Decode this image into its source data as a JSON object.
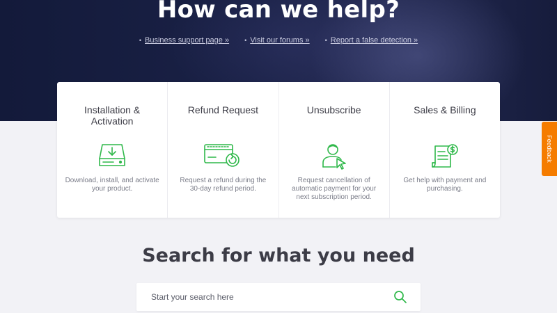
{
  "hero": {
    "title": "How can we help?",
    "links": [
      {
        "label": "Business support page »"
      },
      {
        "label": "Visit our forums »"
      },
      {
        "label": "Report a false detection »"
      }
    ],
    "bullet": "•"
  },
  "cards": [
    {
      "title": "Installation & Activation",
      "icon": "download-drive-icon",
      "description": "Download, install, and activate your product."
    },
    {
      "title": "Refund Request",
      "icon": "refund-card-icon",
      "description": "Request a refund during the 30-day refund period."
    },
    {
      "title": "Unsubscribe",
      "icon": "user-cursor-icon",
      "description": "Request cancellation of automatic payment for your next subscription period."
    },
    {
      "title": "Sales & Billing",
      "icon": "invoice-dollar-icon",
      "description": "Get help with payment and purchasing."
    }
  ],
  "feedback": {
    "label": "Feedback"
  },
  "search": {
    "title": "Search for what you need",
    "placeholder": "Start your search here",
    "icon": "search-icon"
  },
  "colors": {
    "accent": "#2fb84a",
    "feedback": "#f57c00",
    "hero_bg": "#1a2146",
    "page_bg": "#f2f2f6"
  }
}
